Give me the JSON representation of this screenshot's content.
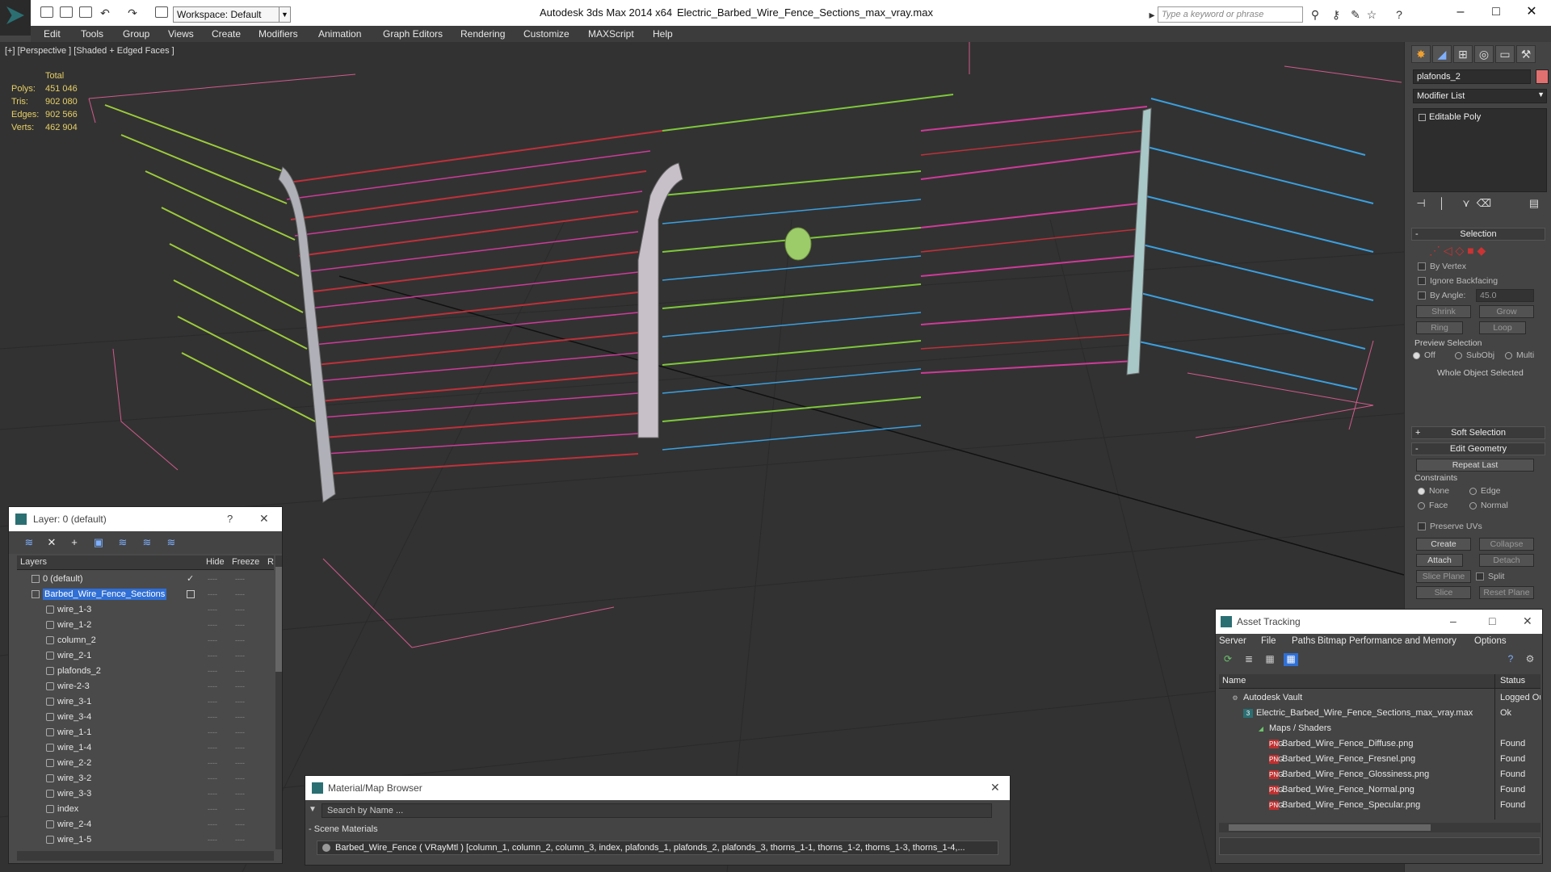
{
  "titlebar": {
    "app_title": "Autodesk 3ds Max  2014 x64",
    "file_title": "Electric_Barbed_Wire_Fence_Sections_max_vray.max",
    "workspace_label": "Workspace: Default",
    "search_placeholder": "Type a keyword or phrase",
    "minimize": "–",
    "maximize": "□",
    "close": "✕"
  },
  "menu": [
    "Edit",
    "Tools",
    "Group",
    "Views",
    "Create",
    "Modifiers",
    "Animation",
    "Graph Editors",
    "Rendering",
    "Customize",
    "MAXScript",
    "Help"
  ],
  "viewport": {
    "label": "[+] [Perspective ] [Shaded + Edged Faces ]",
    "stats": {
      "header": "Total",
      "rows": [
        {
          "label": "Polys:",
          "value": "451 046"
        },
        {
          "label": "Tris:",
          "value": "902 080"
        },
        {
          "label": "Edges:",
          "value": "902 566"
        },
        {
          "label": "Verts:",
          "value": "462 904"
        }
      ]
    }
  },
  "command_panel": {
    "object_name": "plafonds_2",
    "object_color": "#e07070",
    "modifier_list": "Modifier List",
    "stack_item": "Editable Poly",
    "selection_title": "Selection",
    "by_vertex": "By Vertex",
    "ignore_backfacing": "Ignore Backfacing",
    "by_angle": "By Angle:",
    "by_angle_value": "45.0",
    "shrink": "Shrink",
    "grow": "Grow",
    "ring": "Ring",
    "loop": "Loop",
    "preview_selection": "Preview Selection",
    "preview_off": "Off",
    "preview_subobj": "SubObj",
    "preview_multi": "Multi",
    "whole_object": "Whole Object Selected",
    "soft_selection": "Soft Selection",
    "edit_geometry": "Edit Geometry",
    "repeat_last": "Repeat Last",
    "constraints": "Constraints",
    "c_none": "None",
    "c_edge": "Edge",
    "c_face": "Face",
    "c_normal": "Normal",
    "preserve_uvs": "Preserve UVs",
    "create": "Create",
    "collapse": "Collapse",
    "attach": "Attach",
    "detach": "Detach",
    "slice_plane": "Slice Plane",
    "split": "Split",
    "slice": "Slice",
    "reset_plane": "Reset Plane"
  },
  "layer_explorer": {
    "title": "Layer: 0 (default)",
    "help": "?",
    "close": "✕",
    "columns": {
      "layers": "Layers",
      "hide": "Hide",
      "freeze": "Freeze",
      "render": "R"
    },
    "rows": [
      {
        "name": "0 (default)",
        "level": 0,
        "selected": false
      },
      {
        "name": "Barbed_Wire_Fence_Sections",
        "level": 0,
        "selected": true
      },
      {
        "name": "wire_1-3",
        "level": 1,
        "selected": false
      },
      {
        "name": "wire_1-2",
        "level": 1,
        "selected": false
      },
      {
        "name": "column_2",
        "level": 1,
        "selected": false
      },
      {
        "name": "wire_2-1",
        "level": 1,
        "selected": false
      },
      {
        "name": "plafonds_2",
        "level": 1,
        "selected": false
      },
      {
        "name": "wire-2-3",
        "level": 1,
        "selected": false
      },
      {
        "name": "wire_3-1",
        "level": 1,
        "selected": false
      },
      {
        "name": "wire_3-4",
        "level": 1,
        "selected": false
      },
      {
        "name": "wire_1-1",
        "level": 1,
        "selected": false
      },
      {
        "name": "wire_1-4",
        "level": 1,
        "selected": false
      },
      {
        "name": "wire_2-2",
        "level": 1,
        "selected": false
      },
      {
        "name": "wire_3-2",
        "level": 1,
        "selected": false
      },
      {
        "name": "wire_3-3",
        "level": 1,
        "selected": false
      },
      {
        "name": "index",
        "level": 1,
        "selected": false
      },
      {
        "name": "wire_2-4",
        "level": 1,
        "selected": false
      },
      {
        "name": "wire_1-5",
        "level": 1,
        "selected": false
      }
    ]
  },
  "material_browser": {
    "title": "Material/Map Browser",
    "close": "✕",
    "search_placeholder": "Search by Name ...",
    "section": "Scene Materials",
    "item": "Barbed_Wire_Fence  ( VRayMtl ) [column_1, column_2, column_3, index, plafonds_1, plafonds_2, plafonds_3, thorns_1-1, thorns_1-2, thorns_1-3, thorns_1-4,..."
  },
  "asset_tracking": {
    "title": "Asset Tracking",
    "menu": [
      "Server",
      "File",
      "Paths",
      "Bitmap Performance and Memory",
      "Options"
    ],
    "columns": {
      "name": "Name",
      "status": "Status"
    },
    "rows": [
      {
        "name": "Autodesk Vault",
        "status": "Logged Ou",
        "level": 0,
        "icon": "vault-icon"
      },
      {
        "name": "Electric_Barbed_Wire_Fence_Sections_max_vray.max",
        "status": "Ok",
        "level": 1,
        "icon": "max-file-icon"
      },
      {
        "name": "Maps / Shaders",
        "status": "",
        "level": 2,
        "icon": "maps-icon"
      },
      {
        "name": "Barbed_Wire_Fence_Diffuse.png",
        "status": "Found",
        "level": 3,
        "icon": "png-icon"
      },
      {
        "name": "Barbed_Wire_Fence_Fresnel.png",
        "status": "Found",
        "level": 3,
        "icon": "png-icon"
      },
      {
        "name": "Barbed_Wire_Fence_Glossiness.png",
        "status": "Found",
        "level": 3,
        "icon": "png-icon"
      },
      {
        "name": "Barbed_Wire_Fence_Normal.png",
        "status": "Found",
        "level": 3,
        "icon": "png-icon"
      },
      {
        "name": "Barbed_Wire_Fence_Specular.png",
        "status": "Found",
        "level": 3,
        "icon": "png-icon"
      }
    ]
  },
  "colors": {
    "viewport_bg": "#323232",
    "stats_text": "#e8d066",
    "selection_blue": "#2f6fd6",
    "wire_red": "#c0303a",
    "wire_green": "#7ec83a",
    "wire_blue": "#3aa0e0",
    "wire_magenta": "#d03a9a"
  }
}
